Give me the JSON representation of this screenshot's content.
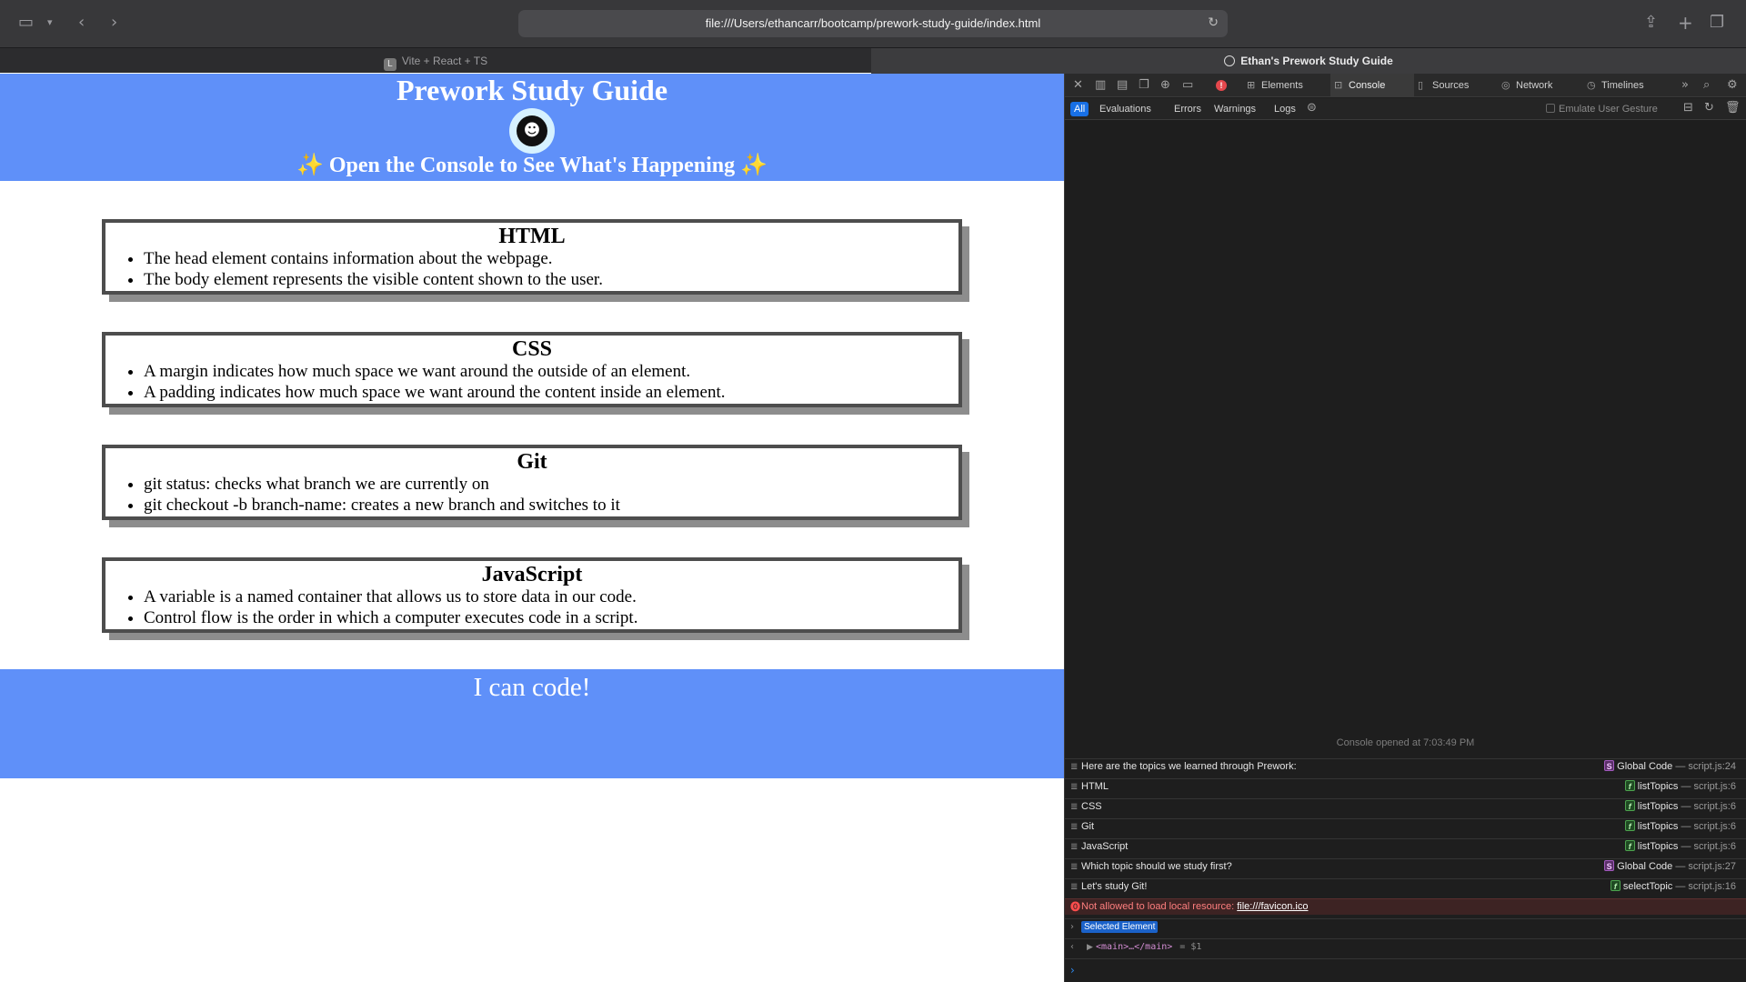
{
  "browser": {
    "url": "file:///Users/ethancarr/bootcamp/prework-study-guide/index.html",
    "tabs": [
      {
        "label": "Vite + React + TS",
        "favicon": "L"
      },
      {
        "label": "Ethan's Prework Study Guide"
      }
    ]
  },
  "page": {
    "title": "Prework Study Guide",
    "subtitle_sparkle_left": "✨",
    "subtitle": "Open the Console to See What's Happening",
    "subtitle_sparkle_right": "✨",
    "sections": [
      {
        "title": "HTML",
        "items": [
          "The head element contains information about the webpage.",
          "The body element represents the visible content shown to the user."
        ]
      },
      {
        "title": "CSS",
        "items": [
          "A margin indicates how much space we want around the outside of an element.",
          "A padding indicates how much space we want around the content inside an element."
        ]
      },
      {
        "title": "Git",
        "items": [
          "git status: checks what branch we are currently on",
          "git checkout -b branch-name: creates a new branch and switches to it"
        ]
      },
      {
        "title": "JavaScript",
        "items": [
          "A variable is a named container that allows us to store data in our code.",
          "Control flow is the order in which a computer executes code in a script."
        ]
      }
    ],
    "footer": "I can code!",
    "colors": {
      "hero": "#5f90f9",
      "card_border": "#4d4d4d",
      "card_shadow": "#8d8d8d"
    }
  },
  "devtools": {
    "tabs": [
      "Elements",
      "Console",
      "Sources",
      "Network",
      "Timelines"
    ],
    "active_tab": "Console",
    "error_badge": "!",
    "filters": [
      "All",
      "Evaluations",
      "Errors",
      "Warnings",
      "Logs"
    ],
    "active_filter": "All",
    "emulate_label": "Emulate User Gesture",
    "console_opened": "Console opened at 7:03:49 PM",
    "logs": [
      {
        "msg": "Here are the topics we learned through Prework:",
        "badge": "S",
        "func": "Global Code",
        "file": "script.js:24"
      },
      {
        "msg": "HTML",
        "badge": "f",
        "func": "listTopics",
        "file": "script.js:6"
      },
      {
        "msg": "CSS",
        "badge": "f",
        "func": "listTopics",
        "file": "script.js:6"
      },
      {
        "msg": "Git",
        "badge": "f",
        "func": "listTopics",
        "file": "script.js:6"
      },
      {
        "msg": "JavaScript",
        "badge": "f",
        "func": "listTopics",
        "file": "script.js:6"
      },
      {
        "msg": "Which topic should we study first?",
        "badge": "S",
        "func": "Global Code",
        "file": "script.js:27"
      },
      {
        "msg": "Let's study Git!",
        "badge": "f",
        "func": "selectTopic",
        "file": "script.js:16"
      }
    ],
    "error": {
      "msg": "Not allowed to load local resource:",
      "link": "file:///favicon.ico"
    },
    "selected_element_label": "Selected Element",
    "selected_element_value": "<main>…</main>",
    "selected_element_var": "= $1",
    "separator": " — "
  }
}
